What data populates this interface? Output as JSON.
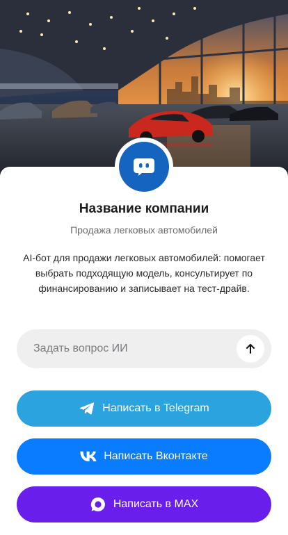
{
  "hero": {
    "image": "car-showroom-photo"
  },
  "company": {
    "avatar_icon": "bot-chat-icon",
    "name": "Название компании",
    "subtitle": "Продажа легковых автомобилей",
    "description": "AI-бот для продажи легковых автомобилей: помогает выбрать подходящую модель, консультирует по финансированию и записывает на тест-драйв."
  },
  "ask": {
    "placeholder": "Задать вопрос ИИ",
    "value": "",
    "send_icon": "arrow-up-icon"
  },
  "buttons": {
    "telegram": {
      "label": "Написать в Telegram",
      "icon": "telegram-icon",
      "color": "#2AA3DF"
    },
    "vk": {
      "label": "Написать Вконтакте",
      "icon": "vk-icon",
      "color": "#0A7CFF"
    },
    "max": {
      "label": "Написать в MAX",
      "icon": "max-icon",
      "color": "#6A1EEB"
    }
  },
  "colors": {
    "avatar": "#1565C0",
    "input_bg": "#EFEFEF"
  }
}
